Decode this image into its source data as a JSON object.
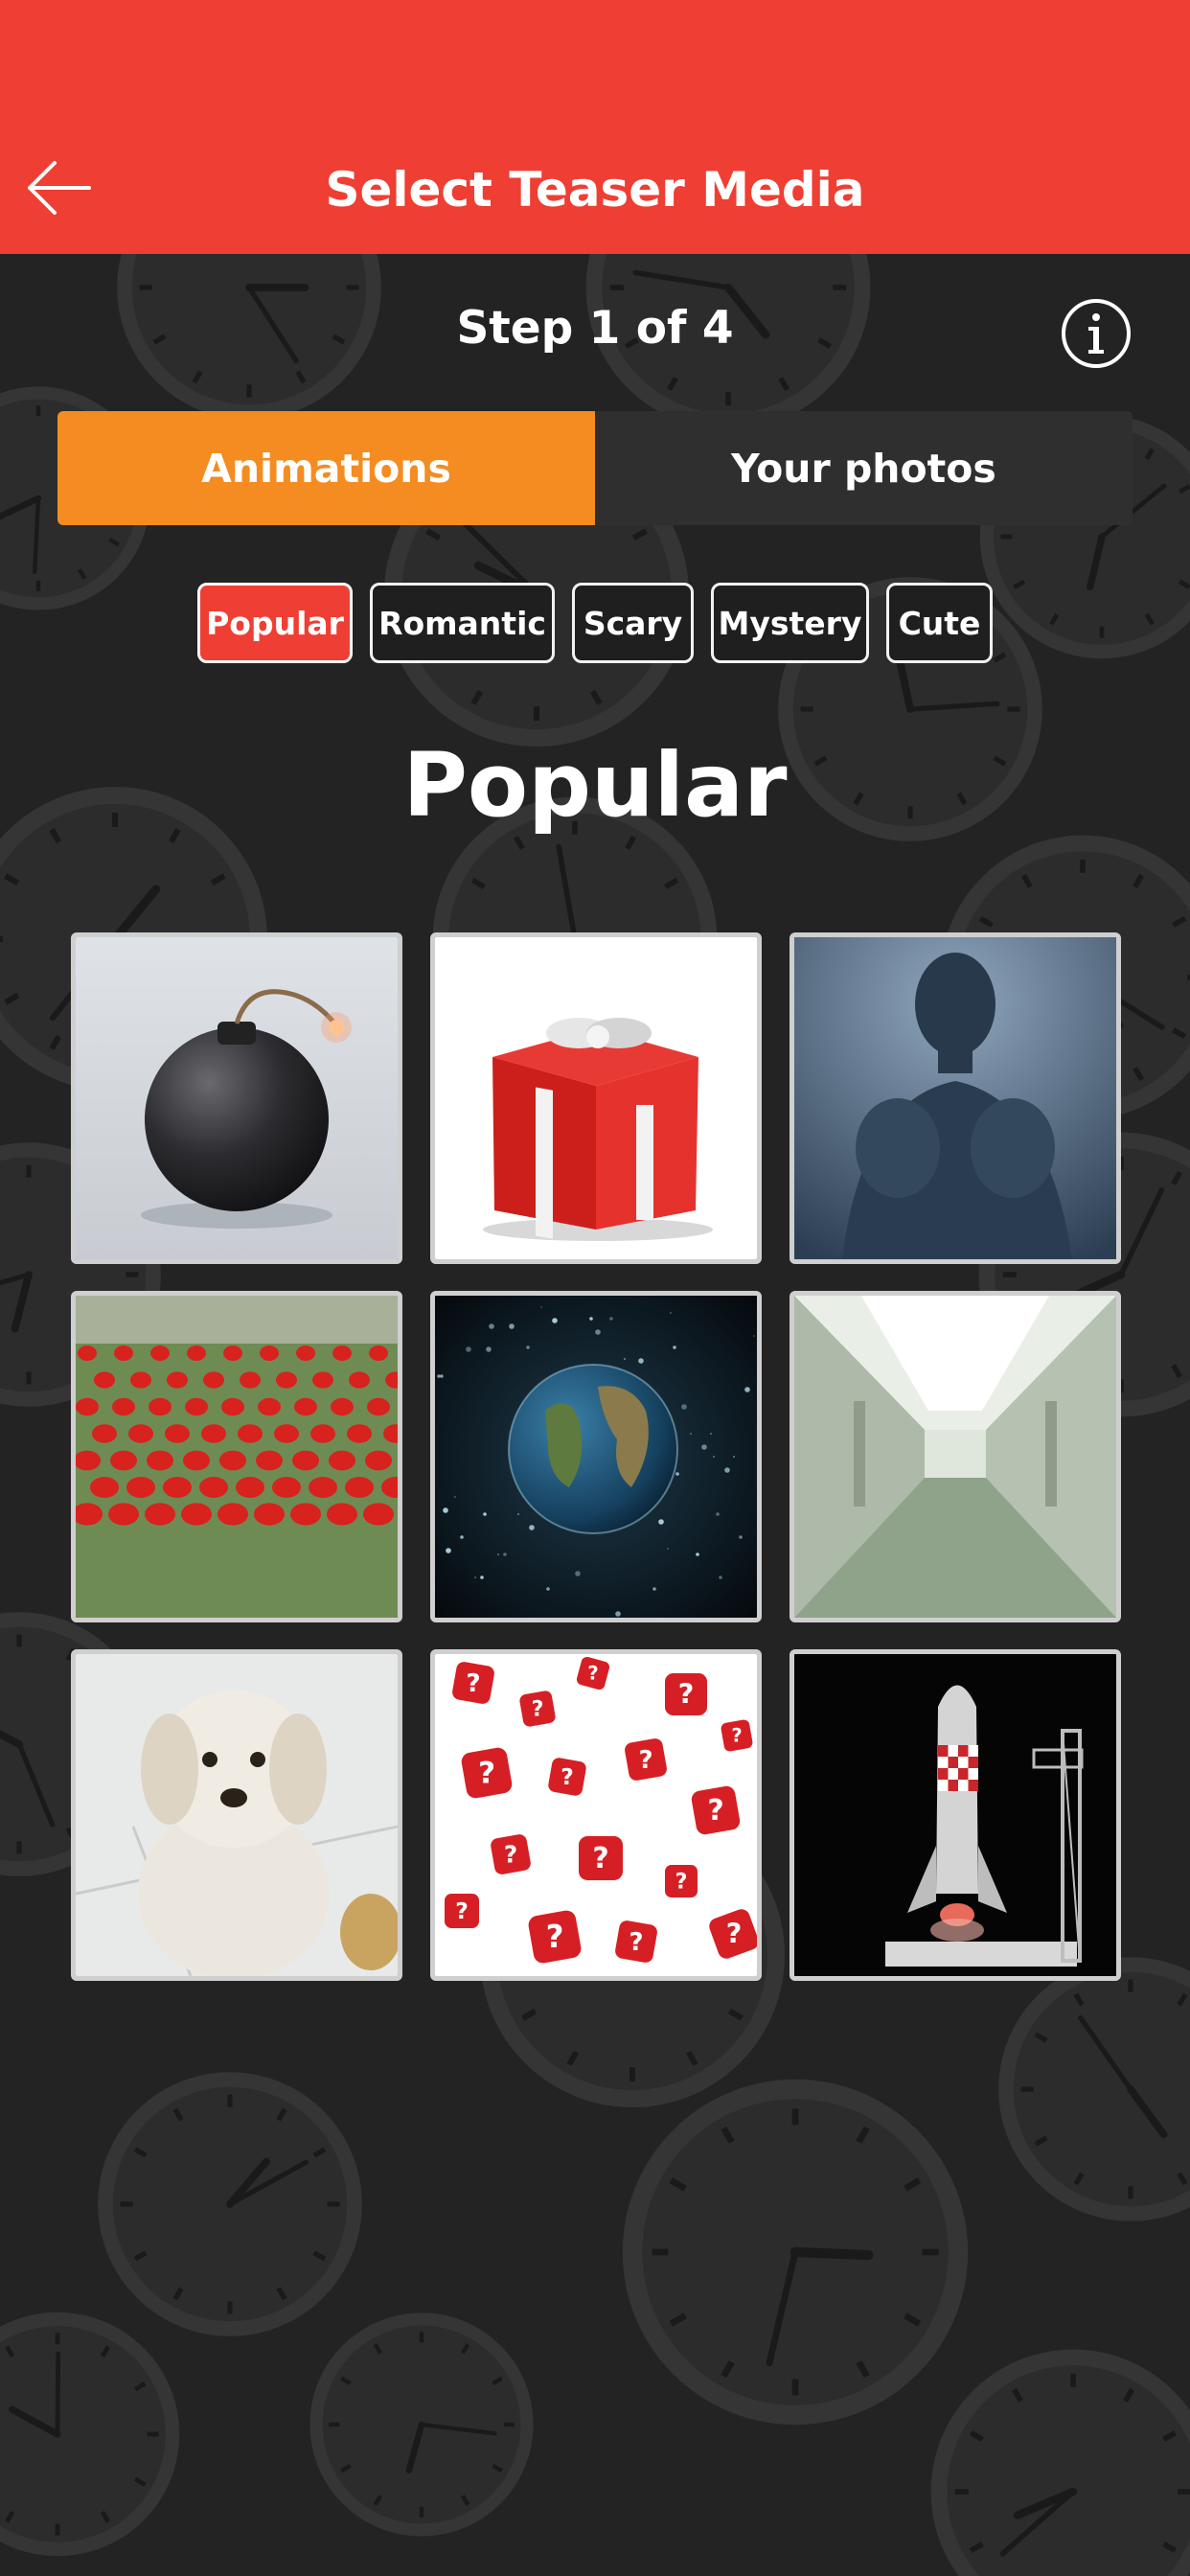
{
  "header": {
    "title": "Select Teaser Media",
    "back_icon": "arrow-left-icon",
    "background_color": "#ef3e33"
  },
  "step": {
    "text": "Step 1 of 4",
    "info_icon": "info-icon"
  },
  "media_tabs": [
    {
      "label": "Animations",
      "active": true,
      "color": "#f48c22"
    },
    {
      "label": "Your photos",
      "active": false
    }
  ],
  "category_chips": [
    {
      "label": "Popular",
      "active": true,
      "color": "#ef3e33"
    },
    {
      "label": "Romantic",
      "active": false
    },
    {
      "label": "Scary",
      "active": false
    },
    {
      "label": "Mystery",
      "active": false
    },
    {
      "label": "Cute",
      "active": false
    }
  ],
  "section": {
    "title": "Popular"
  },
  "media_grid": [
    {
      "subject": "bomb"
    },
    {
      "subject": "red gift box"
    },
    {
      "subject": "silhouette boxer"
    },
    {
      "subject": "red tulip field"
    },
    {
      "subject": "planet earth"
    },
    {
      "subject": "white hallway"
    },
    {
      "subject": "white dog"
    },
    {
      "subject": "red question dice"
    },
    {
      "subject": "rocket launch pad"
    }
  ],
  "background_pattern": "clock-icon"
}
